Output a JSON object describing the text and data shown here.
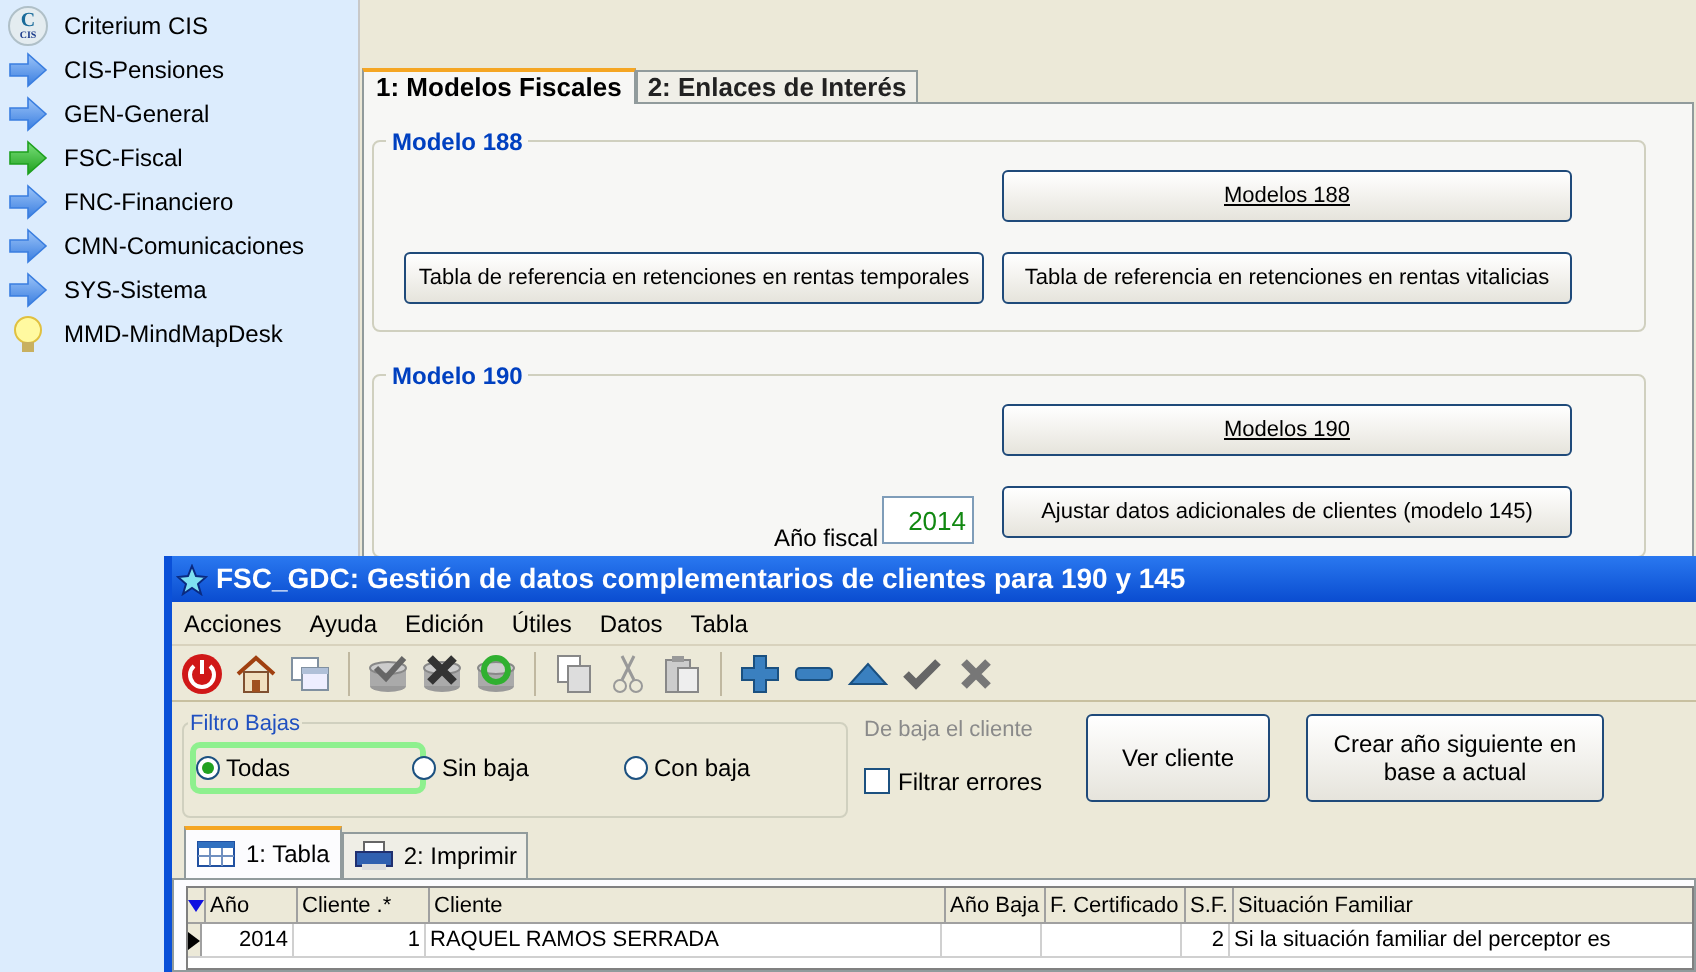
{
  "sidebar": {
    "items": [
      {
        "label": "Criterium CIS",
        "kind": "logo",
        "logo_letters": [
          "C",
          "CIS"
        ]
      },
      {
        "label": "CIS-Pensiones",
        "kind": "arrow",
        "selected": false
      },
      {
        "label": "GEN-General",
        "kind": "arrow",
        "selected": false
      },
      {
        "label": "FSC-Fiscal",
        "kind": "arrow",
        "selected": true
      },
      {
        "label": "FNC-Financiero",
        "kind": "arrow",
        "selected": false
      },
      {
        "label": "CMN-Comunicaciones",
        "kind": "arrow",
        "selected": false
      },
      {
        "label": "SYS-Sistema",
        "kind": "arrow",
        "selected": false
      },
      {
        "label": "MMD-MindMapDesk",
        "kind": "bulb"
      }
    ]
  },
  "tabs": [
    {
      "label": "1: Modelos Fiscales",
      "selected": true
    },
    {
      "label": "2: Enlaces de Interés",
      "selected": false
    }
  ],
  "modelo_188": {
    "title": "Modelo 188",
    "buttons": [
      {
        "label": "Modelos 188",
        "underlined": true
      },
      {
        "label": "Tabla de referencia en retenciones en rentas temporales",
        "underlined": false
      },
      {
        "label": "Tabla de referencia en retenciones en rentas vitalicias",
        "underlined": false
      }
    ]
  },
  "modelo_190": {
    "title": "Modelo 190",
    "buttons": [
      {
        "label": "Modelos 190",
        "underlined": true
      },
      {
        "label": "Ajustar datos adicionales de clientes (modelo 145)",
        "underlined": false
      }
    ],
    "fiscal_year": {
      "label": "Año fiscal",
      "value": "2014"
    }
  },
  "child_window": {
    "title": "FSC_GDC: Gestión de datos complementarios de clientes para 190 y 145",
    "menu": [
      "Acciones",
      "Ayuda",
      "Edición",
      "Útiles",
      "Datos",
      "Tabla"
    ],
    "filter": {
      "title": "Filtro Bajas",
      "options": [
        {
          "label": "Todas",
          "selected": true
        },
        {
          "label": "Sin baja",
          "selected": false
        },
        {
          "label": "Con baja",
          "selected": false
        }
      ]
    },
    "baja_label": "De baja el cliente",
    "filter_errors": {
      "label": "Filtrar errores",
      "checked": false
    },
    "buttons": [
      "Ver cliente",
      "Crear año siguiente en base a actual"
    ],
    "tabs": [
      {
        "label": "1: Tabla",
        "kind": "table",
        "selected": true
      },
      {
        "label": "2: Imprimir",
        "kind": "print",
        "selected": false
      }
    ],
    "table": {
      "columns": [
        "Año",
        "Cliente .*",
        "Cliente",
        "Año Baja",
        "F. Certificado",
        "S.F.",
        "Situación Familiar"
      ],
      "rows": [
        [
          "2014",
          "1",
          "RAQUEL RAMOS SERRADA",
          "",
          "",
          "2",
          "Si la situación familiar del perceptor es"
        ]
      ]
    }
  }
}
